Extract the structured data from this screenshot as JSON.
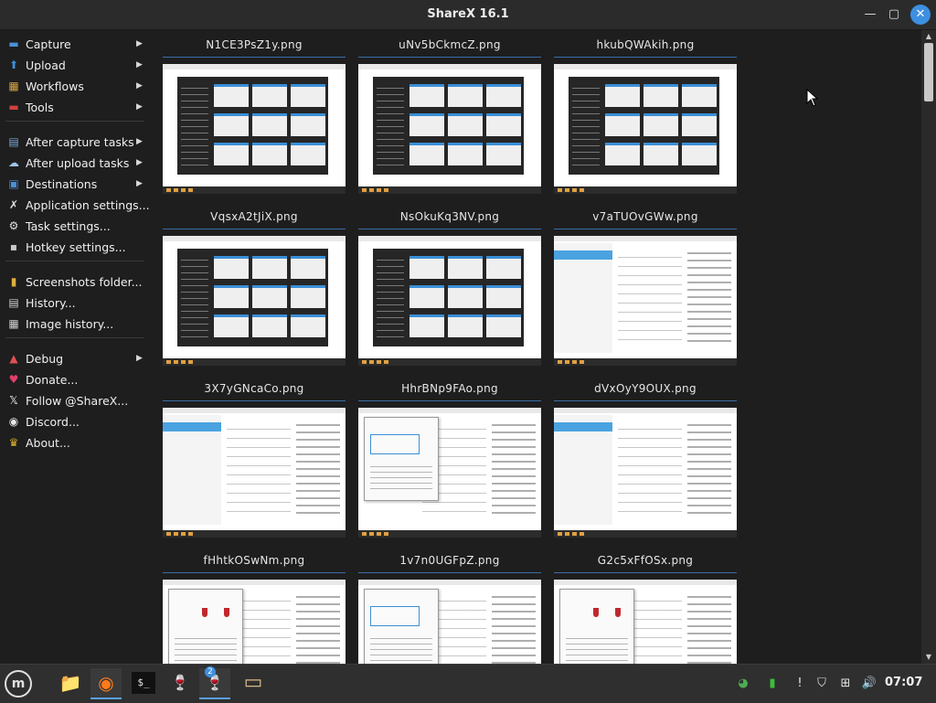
{
  "window": {
    "title": "ShareX 16.1",
    "controls": {
      "minimize": "—",
      "maximize": "▢",
      "close": "✕"
    }
  },
  "sidebar": {
    "items": [
      {
        "label": "Capture",
        "icon": "capture-icon",
        "glyph": "▬",
        "color": "#4a90d9",
        "submenu": true
      },
      {
        "label": "Upload",
        "icon": "upload-icon",
        "glyph": "⬆",
        "color": "#3d8fe0",
        "submenu": true
      },
      {
        "label": "Workflows",
        "icon": "workflows-icon",
        "glyph": "▦",
        "color": "#d9a441",
        "submenu": true
      },
      {
        "label": "Tools",
        "icon": "tools-icon",
        "glyph": "▬",
        "color": "#d04040",
        "submenu": true
      },
      {
        "label": "After capture tasks",
        "icon": "after-capture-icon",
        "glyph": "▤",
        "color": "#7aa7d8",
        "submenu": true
      },
      {
        "label": "After upload tasks",
        "icon": "after-upload-icon",
        "glyph": "☁",
        "color": "#9fc3ea",
        "submenu": true
      },
      {
        "label": "Destinations",
        "icon": "destinations-icon",
        "glyph": "▣",
        "color": "#4a90d9",
        "submenu": true
      },
      {
        "label": "Application settings...",
        "icon": "application-settings-icon",
        "glyph": "✗",
        "color": "#e0e0e0",
        "submenu": false
      },
      {
        "label": "Task settings...",
        "icon": "task-settings-icon",
        "glyph": "⚙",
        "color": "#e0e0e0",
        "submenu": false
      },
      {
        "label": "Hotkey settings...",
        "icon": "hotkey-settings-icon",
        "glyph": "▪",
        "color": "#c8c8c8",
        "submenu": false
      },
      {
        "label": "Screenshots folder...",
        "icon": "screenshots-folder-icon",
        "glyph": "▮",
        "color": "#e0b040",
        "submenu": false
      },
      {
        "label": "History...",
        "icon": "history-icon",
        "glyph": "▤",
        "color": "#d0d0d0",
        "submenu": false
      },
      {
        "label": "Image history...",
        "icon": "image-history-icon",
        "glyph": "▦",
        "color": "#d0d0d0",
        "submenu": false
      },
      {
        "label": "Debug",
        "icon": "debug-icon",
        "glyph": "▲",
        "color": "#e05050",
        "submenu": true
      },
      {
        "label": "Donate...",
        "icon": "donate-icon",
        "glyph": "♥",
        "color": "#e0406a",
        "submenu": false
      },
      {
        "label": "Follow @ShareX...",
        "icon": "x-logo-icon",
        "glyph": "𝕏",
        "color": "#f0f0f0",
        "submenu": false
      },
      {
        "label": "Discord...",
        "icon": "discord-icon",
        "glyph": "◉",
        "color": "#e8e8e8",
        "submenu": false
      },
      {
        "label": "About...",
        "icon": "about-icon",
        "glyph": "♛",
        "color": "#e0b030",
        "submenu": false
      }
    ]
  },
  "gallery": {
    "files": [
      {
        "name": "N1CE3PsZ1y.png",
        "style": "dark"
      },
      {
        "name": "uNv5bCkmcZ.png",
        "style": "dark"
      },
      {
        "name": "hkubQWAkih.png",
        "style": "dark"
      },
      {
        "name": "VqsxA2tJiX.png",
        "style": "dark"
      },
      {
        "name": "NsOkuKq3NV.png",
        "style": "dark"
      },
      {
        "name": "v7aTUOvGWw.png",
        "style": "light"
      },
      {
        "name": "3X7yGNcaCo.png",
        "style": "light"
      },
      {
        "name": "HhrBNp9FAo.png",
        "style": "dialog"
      },
      {
        "name": "dVxOyY9OUX.png",
        "style": "light"
      },
      {
        "name": "fHhtkOSwNm.png",
        "style": "wine"
      },
      {
        "name": "1v7n0UGFpZ.png",
        "style": "dialog"
      },
      {
        "name": "G2c5xFfOSx.png",
        "style": "wine"
      }
    ]
  },
  "scrollbar": {
    "up": "▲",
    "down": "▼"
  },
  "taskbar": {
    "menu_glyph": "m",
    "apps": [
      {
        "name": "files",
        "glyph": "📁"
      },
      {
        "name": "firefox",
        "glyph": "◉"
      },
      {
        "name": "terminal",
        "glyph": "$_"
      },
      {
        "name": "wine-1",
        "glyph": "🍷"
      },
      {
        "name": "wine-2",
        "glyph": "🍷"
      },
      {
        "name": "package",
        "glyph": "▭"
      }
    ],
    "window_badge": "2",
    "tray": [
      {
        "name": "chrome",
        "glyph": "◕"
      },
      {
        "name": "battery",
        "glyph": "▮"
      },
      {
        "name": "notification",
        "glyph": "!"
      },
      {
        "name": "shield",
        "glyph": "⛉"
      },
      {
        "name": "network",
        "glyph": "⊞"
      },
      {
        "name": "volume",
        "glyph": "🔊"
      }
    ],
    "clock": "07:07"
  }
}
